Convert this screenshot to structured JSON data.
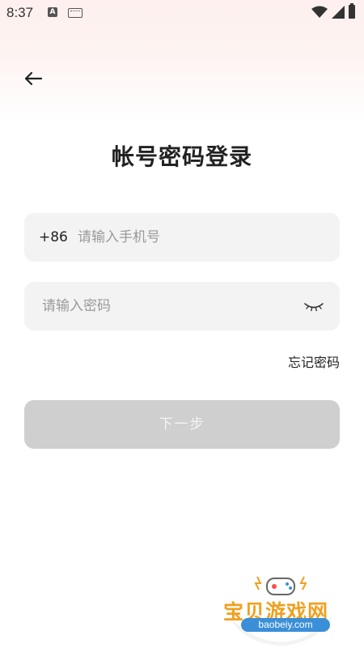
{
  "status_bar": {
    "time": "8:37",
    "a_glyph": "A"
  },
  "header": {
    "back_icon": "arrow-left-icon"
  },
  "title": "帐号密码登录",
  "phone": {
    "country_code": "+86",
    "placeholder": "请输入手机号",
    "value": ""
  },
  "password": {
    "placeholder": "请输入密码",
    "value": "",
    "toggle_icon": "eye-closed-icon"
  },
  "forgot_password": "忘记密码",
  "next_button": "下一步",
  "watermark": {
    "name": "宝贝游戏网",
    "url": "baobeiy.com"
  },
  "colors": {
    "button_disabled": "#cfcfcf",
    "field_bg": "#f3f3f3",
    "watermark_orange": "#f0a020",
    "watermark_blue": "#3a8fd8"
  }
}
